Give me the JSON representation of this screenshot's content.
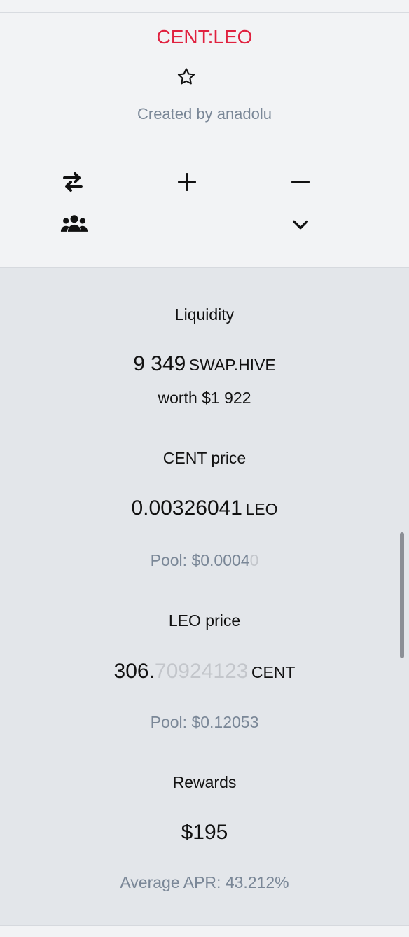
{
  "header": {
    "pair_title": "CENT:LEO",
    "created_by": "Created by anadolu",
    "icons": {
      "favorite": "star-icon",
      "swap": "swap-arrows-icon",
      "add_liquidity": "plus-icon",
      "remove_liquidity": "minus-icon",
      "liquidity_providers": "users-icon",
      "expand": "chevron-down-icon"
    },
    "colors": {
      "title": "#e0213f",
      "muted": "#7a8797"
    }
  },
  "liquidity": {
    "label": "Liquidity",
    "value": "9 349",
    "unit": "SWAP.HIVE",
    "worth": "worth $1 922"
  },
  "cent_price": {
    "label": "CENT price",
    "value": "0.00326041",
    "unit": "LEO",
    "pool_prefix": "Pool: $0.0004",
    "pool_faded": "0"
  },
  "leo_price": {
    "label": "LEO price",
    "value_main": "306.",
    "value_faded": "70924123",
    "unit": "CENT",
    "pool": "Pool: $0.12053"
  },
  "rewards": {
    "label": "Rewards",
    "value": "$195",
    "apr": "Average APR: 43.212%"
  }
}
